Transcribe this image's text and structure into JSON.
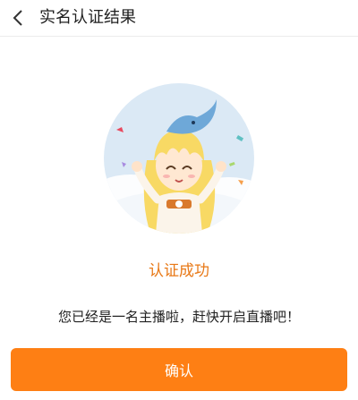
{
  "header": {
    "title": "实名认证结果",
    "back_icon": "chevron-left-icon"
  },
  "result": {
    "title": "认证成功",
    "description": "您已经是一名主播啦，赶快开启直播吧！"
  },
  "actions": {
    "confirm_label": "确认"
  },
  "colors": {
    "accent": "#fe7f14",
    "success_text": "#e87816",
    "avatar_bg": "#dbe9f5"
  }
}
